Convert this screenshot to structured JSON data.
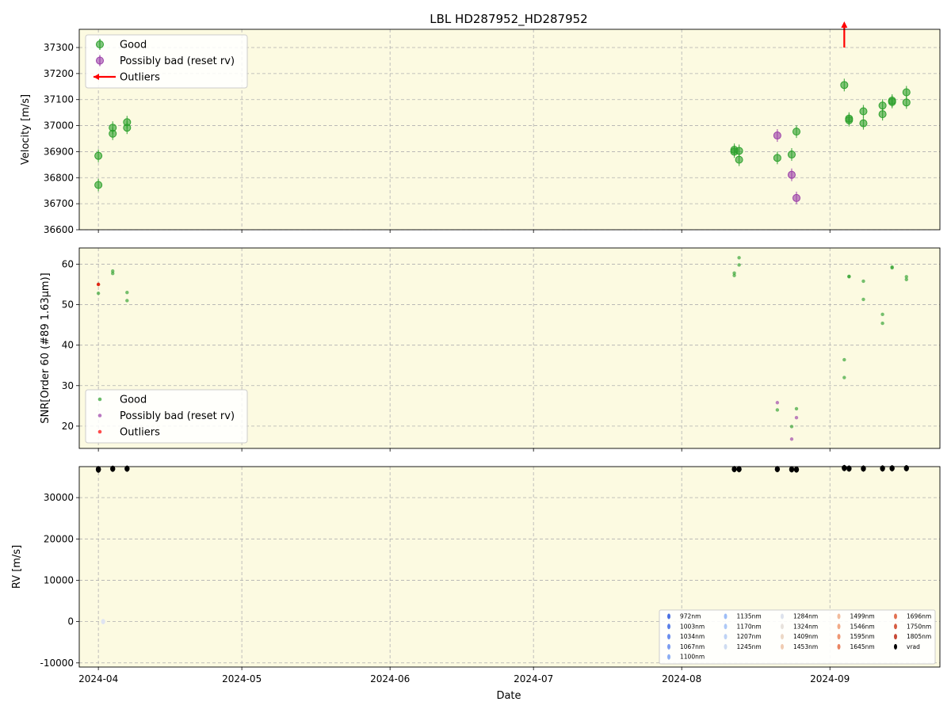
{
  "title": "LBL HD287952_HD287952",
  "xlabel": "Date",
  "colors": {
    "panel_bg": "#fcfae1",
    "good": "#2ca02c",
    "possibly_bad": "#9b3fa8",
    "outlier": "#ff0000",
    "vrad": "#000000",
    "grid": "#b0b0b0"
  },
  "chart_data": [
    {
      "type": "scatter",
      "panel": "velocity",
      "ylabel": "Velocity [m/s]",
      "ylim": [
        36600,
        37370
      ],
      "yticks": [
        36600,
        36700,
        36800,
        36900,
        37000,
        37100,
        37200,
        37300
      ],
      "xlim": [
        "2024-03-28",
        "2024-09-24"
      ],
      "xticks": [
        "2024-04",
        "2024-05",
        "2024-06",
        "2024-07",
        "2024-08",
        "2024-09"
      ],
      "grid": true,
      "legend_position": "top-left",
      "legend": [
        "Good",
        "Possibly bad (reset rv)",
        "Outliers"
      ],
      "series": [
        {
          "name": "Good",
          "points": [
            [
              "2024-04-01",
              36772
            ],
            [
              "2024-04-01",
              36884
            ],
            [
              "2024-04-04",
              36969
            ],
            [
              "2024-04-04",
              36992
            ],
            [
              "2024-04-07",
              36992
            ],
            [
              "2024-04-07",
              37013
            ],
            [
              "2024-08-12",
              36907
            ],
            [
              "2024-08-12",
              36900
            ],
            [
              "2024-08-13",
              36903
            ],
            [
              "2024-08-13",
              36869
            ],
            [
              "2024-08-21",
              36876
            ],
            [
              "2024-08-24",
              36889
            ],
            [
              "2024-08-25",
              36977
            ],
            [
              "2024-09-04",
              37156
            ],
            [
              "2024-09-05",
              37027
            ],
            [
              "2024-09-05",
              37021
            ],
            [
              "2024-09-08",
              37055
            ],
            [
              "2024-09-08",
              37009
            ],
            [
              "2024-09-12",
              37077
            ],
            [
              "2024-09-12",
              37044
            ],
            [
              "2024-09-14",
              37096
            ],
            [
              "2024-09-14",
              37091
            ],
            [
              "2024-09-17",
              37128
            ],
            [
              "2024-09-17",
              37089
            ]
          ]
        },
        {
          "name": "Possibly bad (reset rv)",
          "points": [
            [
              "2024-08-21",
              36962
            ],
            [
              "2024-08-24",
              36811
            ],
            [
              "2024-08-25",
              36722
            ]
          ]
        },
        {
          "name": "Outliers",
          "points": [
            [
              "2024-09-04",
              37300
            ]
          ],
          "note": "arrow"
        }
      ]
    },
    {
      "type": "scatter",
      "panel": "snr",
      "ylabel": "SNR[Order 60 (#89 1.63μm)]",
      "ylim": [
        14.5,
        64
      ],
      "yticks": [
        20,
        30,
        40,
        50,
        60
      ],
      "grid": true,
      "legend_position": "bottom-left",
      "legend": [
        "Good",
        "Possibly bad (reset rv)",
        "Outliers"
      ],
      "series": [
        {
          "name": "Good",
          "points": [
            [
              "2024-04-01",
              52.8
            ],
            [
              "2024-04-01",
              55.0
            ],
            [
              "2024-04-04",
              57.7
            ],
            [
              "2024-04-04",
              58.3
            ],
            [
              "2024-04-07",
              53.0
            ],
            [
              "2024-04-07",
              51.0
            ],
            [
              "2024-08-12",
              57.2
            ],
            [
              "2024-08-12",
              57.8
            ],
            [
              "2024-08-13",
              61.6
            ],
            [
              "2024-08-13",
              59.8
            ],
            [
              "2024-08-21",
              24.0
            ],
            [
              "2024-08-24",
              19.9
            ],
            [
              "2024-08-25",
              24.3
            ],
            [
              "2024-09-04",
              36.4
            ],
            [
              "2024-09-04",
              32.0
            ],
            [
              "2024-09-05",
              57.0
            ],
            [
              "2024-09-05",
              56.9
            ],
            [
              "2024-09-08",
              55.8
            ],
            [
              "2024-09-08",
              51.3
            ],
            [
              "2024-09-12",
              47.6
            ],
            [
              "2024-09-12",
              45.4
            ],
            [
              "2024-09-14",
              59.3
            ],
            [
              "2024-09-14",
              59.1
            ],
            [
              "2024-09-17",
              56.9
            ],
            [
              "2024-09-17",
              56.2
            ]
          ]
        },
        {
          "name": "Possibly bad (reset rv)",
          "points": [
            [
              "2024-08-21",
              25.8
            ],
            [
              "2024-08-24",
              16.8
            ],
            [
              "2024-08-25",
              22.1
            ]
          ]
        },
        {
          "name": "Outliers",
          "points": [
            [
              "2024-04-01",
              55.0
            ]
          ]
        }
      ]
    },
    {
      "type": "scatter",
      "panel": "rv",
      "ylabel": "RV [m/s]",
      "ylim": [
        -11000,
        37500
      ],
      "yticks": [
        -10000,
        0,
        10000,
        20000,
        30000
      ],
      "grid": true,
      "legend_position": "bottom-right",
      "legend": [
        "972nm",
        "1003nm",
        "1034nm",
        "1067nm",
        "1100nm",
        "1135nm",
        "1170nm",
        "1207nm",
        "1245nm",
        "1284nm",
        "1324nm",
        "1409nm",
        "1453nm",
        "1499nm",
        "1546nm",
        "1595nm",
        "1645nm",
        "1696nm",
        "1750nm",
        "1805nm",
        "vrad"
      ],
      "legend_colors": [
        "#4a6fe3",
        "#5a7fe8",
        "#6b8eee",
        "#7c9df1",
        "#8caef4",
        "#9dbdf6",
        "#aec9f6",
        "#bfd3f5",
        "#cfdcf1",
        "#dde2ec",
        "#e8e2dc",
        "#ecd8c6",
        "#f0cbb1",
        "#f2bc9d",
        "#f2ab88",
        "#ef9874",
        "#ea8562",
        "#e27151",
        "#d65d43",
        "#c74a37",
        "#000000"
      ],
      "series": [
        {
          "name": "vrad",
          "points": [
            [
              "2024-04-01",
              36772
            ],
            [
              "2024-04-01",
              36884
            ],
            [
              "2024-04-04",
              36980
            ],
            [
              "2024-04-07",
              37000
            ],
            [
              "2024-08-12",
              36900
            ],
            [
              "2024-08-13",
              36880
            ],
            [
              "2024-08-21",
              36900
            ],
            [
              "2024-08-24",
              36850
            ],
            [
              "2024-08-25",
              36800
            ],
            [
              "2024-09-04",
              37156
            ],
            [
              "2024-09-05",
              37025
            ],
            [
              "2024-09-08",
              37030
            ],
            [
              "2024-09-12",
              37060
            ],
            [
              "2024-09-14",
              37093
            ],
            [
              "2024-09-17",
              37110
            ]
          ]
        },
        {
          "name": "972nm",
          "points": [
            [
              "2024-04-02",
              0
            ]
          ]
        }
      ]
    }
  ]
}
